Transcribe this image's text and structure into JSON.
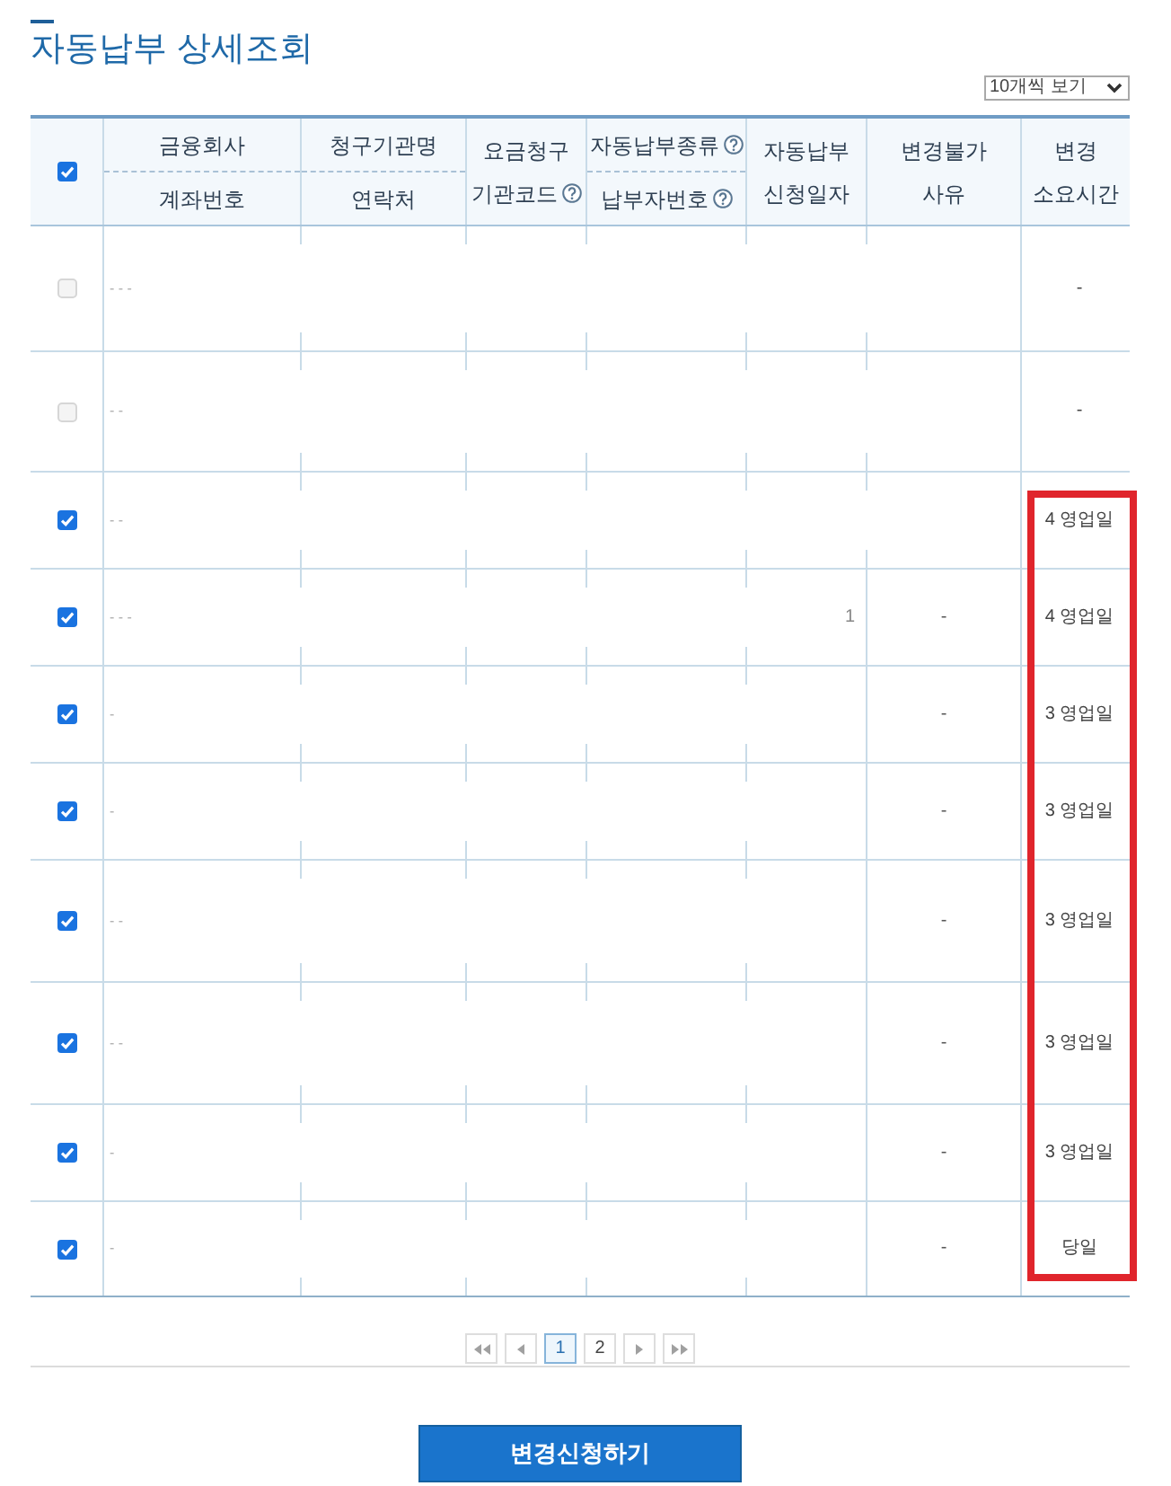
{
  "title": "자동납부 상세조회",
  "page_size_select": {
    "value": "10개씩 보기"
  },
  "table": {
    "header_checkbox": {
      "checked": true
    },
    "columns": [
      {
        "kind": "stacked",
        "parts": [
          {
            "text": "금융회사",
            "help": false
          },
          {
            "text": "계좌번호",
            "help": false
          }
        ]
      },
      {
        "kind": "stacked",
        "parts": [
          {
            "text": "청구기관명",
            "help": false
          },
          {
            "text": "연락처",
            "help": false
          }
        ]
      },
      {
        "kind": "single",
        "text": "요금청구\n기관코드",
        "help": true
      },
      {
        "kind": "stacked",
        "parts": [
          {
            "text": "자동납부종류",
            "help": true
          },
          {
            "text": "납부자번호",
            "help": true
          }
        ]
      },
      {
        "kind": "single",
        "text": "자동납부\n신청일자",
        "help": false
      },
      {
        "kind": "single",
        "text": "변경불가\n사유",
        "help": false
      },
      {
        "kind": "single",
        "text": "변경\n소요시간",
        "help": false
      }
    ],
    "rows": [
      {
        "checked": false,
        "disabled": true,
        "account": "- - -",
        "duration": "-"
      },
      {
        "checked": false,
        "disabled": true,
        "account": "- -",
        "duration": "-"
      },
      {
        "checked": true,
        "disabled": false,
        "account": "- -",
        "duration": "4 영업일"
      },
      {
        "checked": true,
        "disabled": false,
        "account": "- - -",
        "date": "1",
        "reason": "-",
        "duration": "4 영업일"
      },
      {
        "checked": true,
        "disabled": false,
        "account": "-",
        "reason": "-",
        "duration": "3 영업일"
      },
      {
        "checked": true,
        "disabled": false,
        "account": "-",
        "reason": "-",
        "duration": "3 영업일"
      },
      {
        "checked": true,
        "disabled": false,
        "account": "- -",
        "reason": "-",
        "duration": "3 영업일"
      },
      {
        "checked": true,
        "disabled": false,
        "account": "- -",
        "reason": "-",
        "duration": "3 영업일"
      },
      {
        "checked": true,
        "disabled": false,
        "account": "-",
        "reason": "-",
        "duration": "3 영업일"
      },
      {
        "checked": true,
        "disabled": false,
        "account": "-",
        "reason": "-",
        "duration": "당일"
      }
    ]
  },
  "highlight": {
    "kind": "frame"
  },
  "pagination": {
    "pages": [
      {
        "label": "1",
        "selected": true
      },
      {
        "label": "2",
        "selected": false
      }
    ]
  },
  "submit_button": {
    "label": "변경신청하기"
  }
}
